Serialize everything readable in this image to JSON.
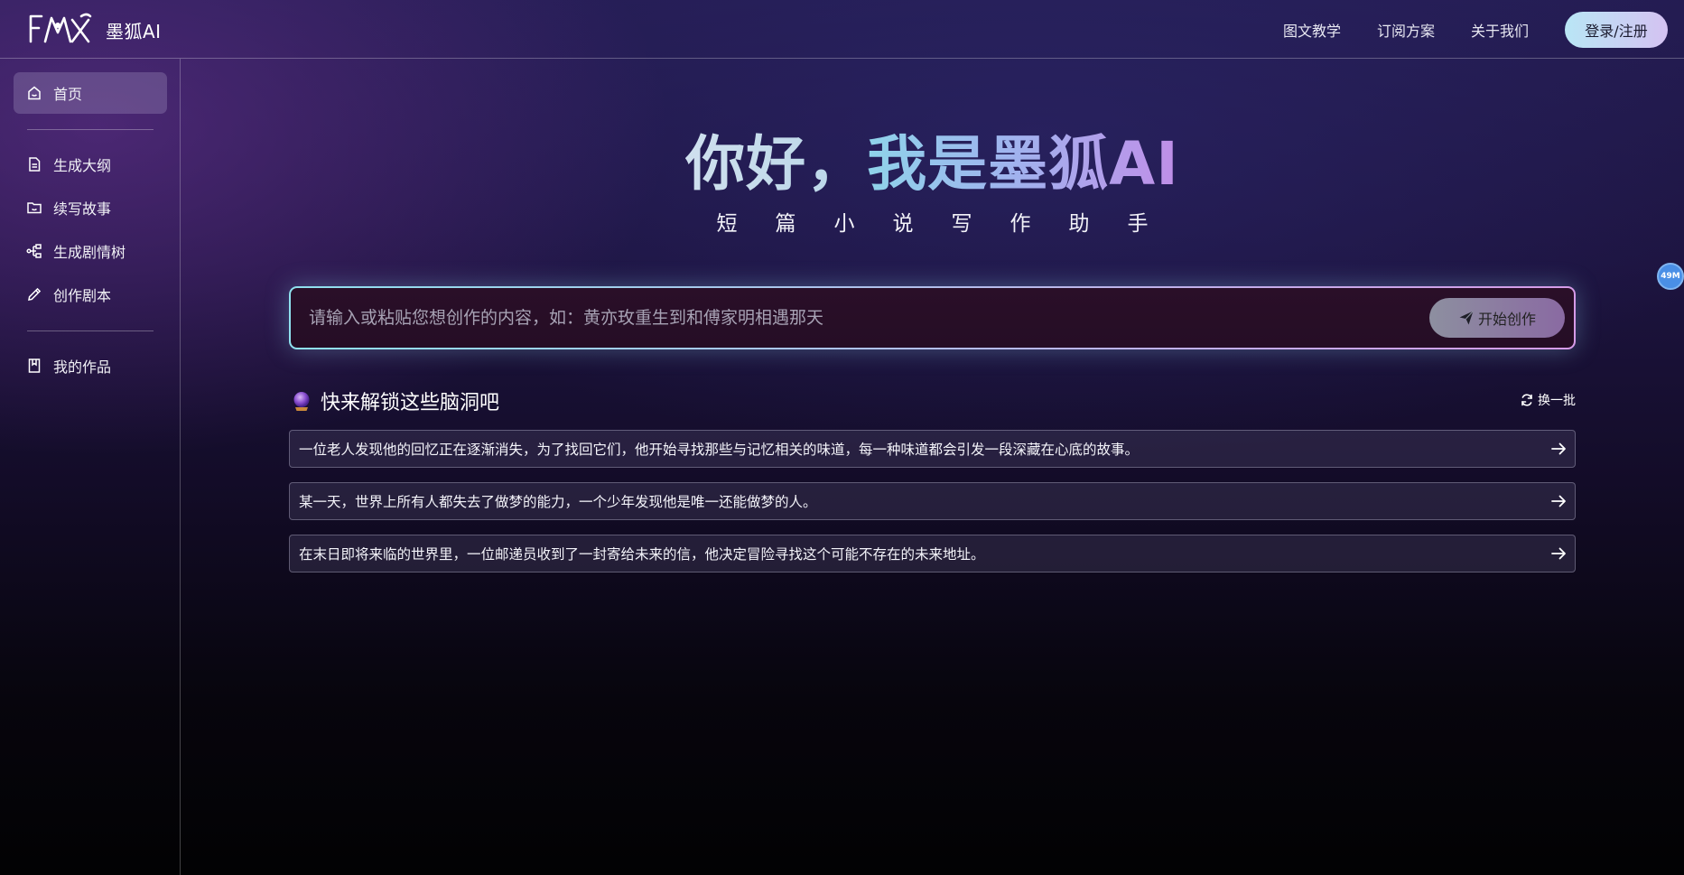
{
  "header": {
    "brand": "墨狐AI",
    "nav": [
      "图文教学",
      "订阅方案",
      "关于我们"
    ],
    "login_label": "登录/注册"
  },
  "sidebar": {
    "items": [
      {
        "label": "首页",
        "icon": "home-icon",
        "active": true
      },
      {
        "label": "生成大纲",
        "icon": "document-icon"
      },
      {
        "label": "续写故事",
        "icon": "folder-icon"
      },
      {
        "label": "生成剧情树",
        "icon": "tree-icon"
      },
      {
        "label": "创作剧本",
        "icon": "pencil-icon"
      },
      {
        "label": "我的作品",
        "icon": "bookmark-book-icon"
      }
    ]
  },
  "hero": {
    "greeting": "你好，",
    "name": "我是墨狐AI",
    "subtitle": "短篇小说写作助手"
  },
  "composer": {
    "placeholder": "请输入或粘贴您想创作的内容，如：黄亦玫重生到和傅家明相遇那天",
    "start_label": "开始创作"
  },
  "suggestions": {
    "title": "快来解锁这些脑洞吧",
    "refresh_label": "换一批",
    "items": [
      "一位老人发现他的回忆正在逐渐消失，为了找回它们，他开始寻找那些与记忆相关的味道，每一种味道都会引发一段深藏在心底的故事。",
      "某一天，世界上所有人都失去了做梦的能力，一个少年发现他是唯一还能做梦的人。",
      "在末日即将来临的世界里，一位邮递员收到了一封寄给未来的信，他决定冒险寻找这个可能不存在的未来地址。"
    ]
  },
  "badge": "49M",
  "colors": {
    "accent_cyan": "#8fe1ee",
    "accent_purple": "#c08ee8",
    "background": "#1d1440"
  }
}
